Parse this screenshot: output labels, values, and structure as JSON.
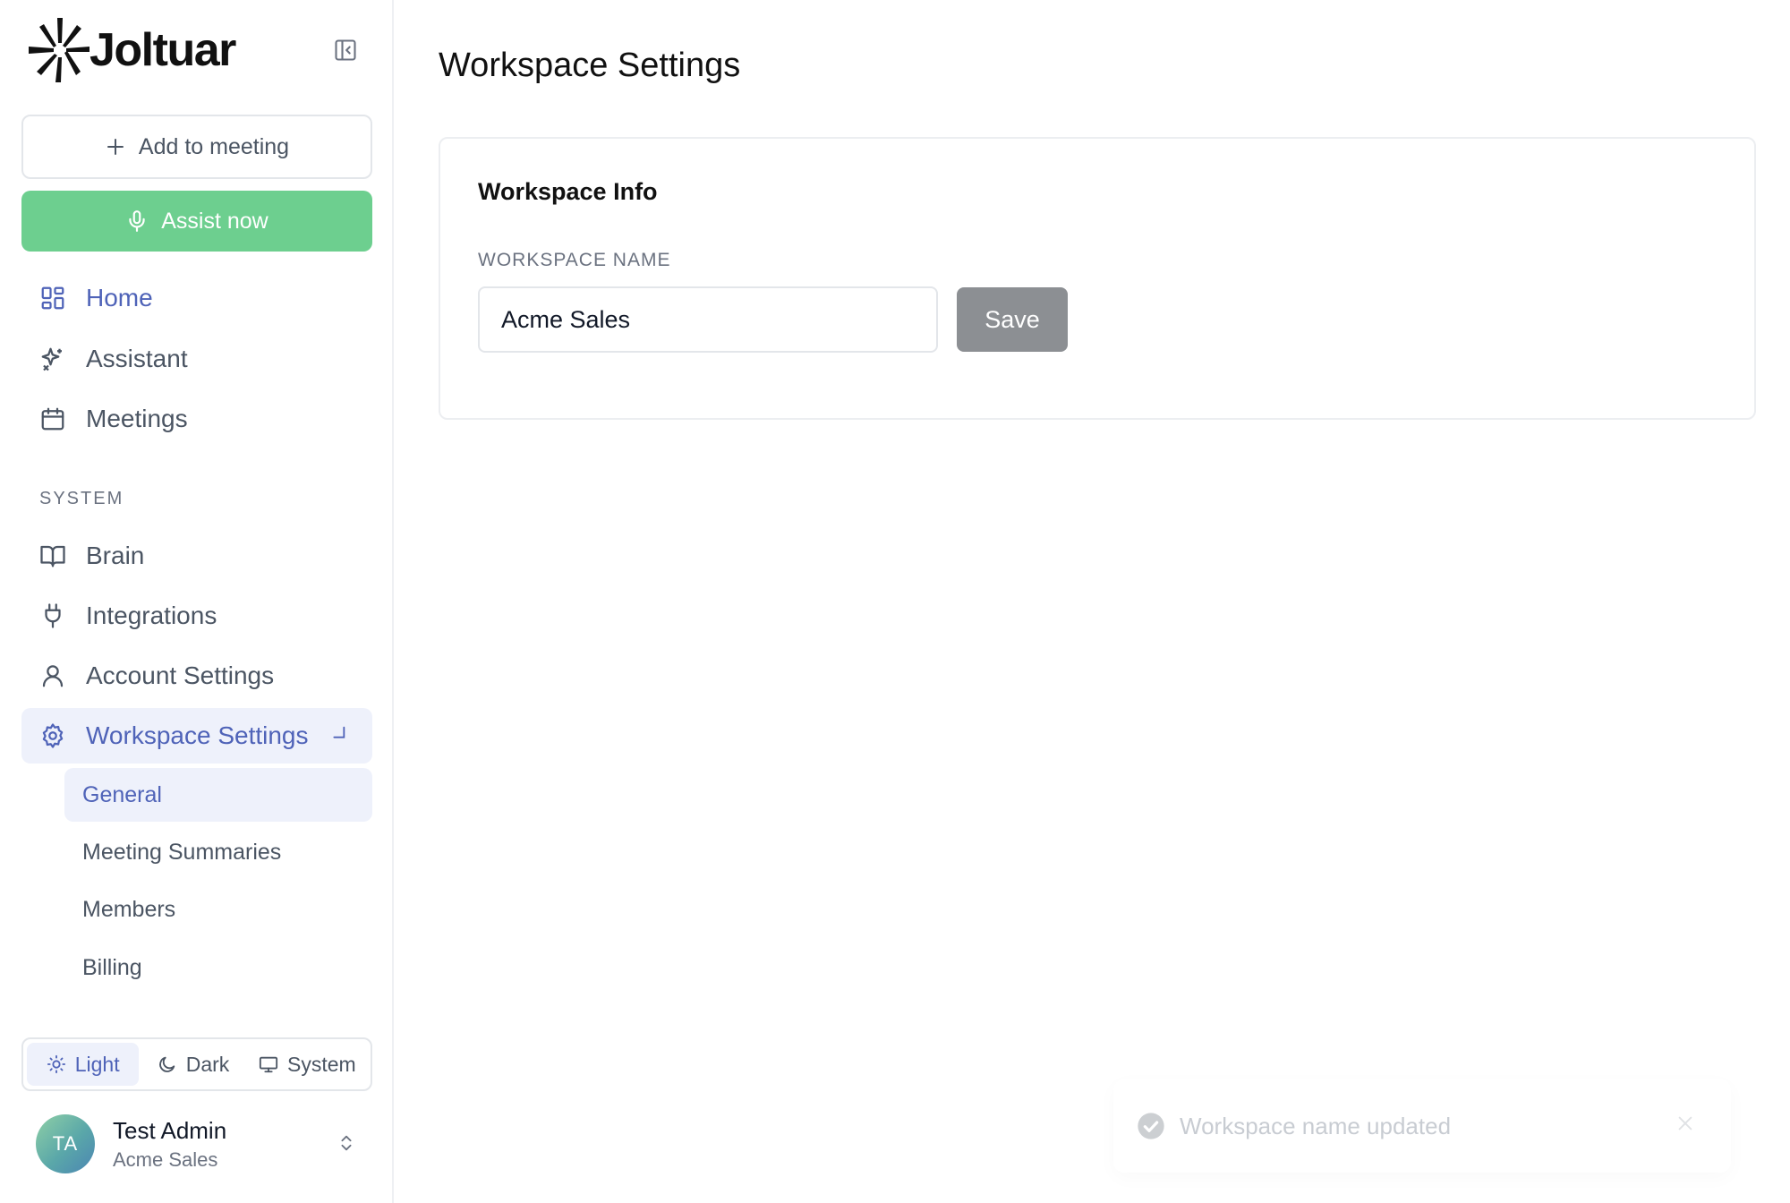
{
  "brand": {
    "name": "Joltuar"
  },
  "sidebar": {
    "add_to_meeting_label": "Add to meeting",
    "assist_now_label": "Assist now",
    "main_nav": [
      {
        "label": "Home",
        "icon": "grid-icon"
      },
      {
        "label": "Assistant",
        "icon": "sparkles-icon"
      },
      {
        "label": "Meetings",
        "icon": "calendar-icon"
      }
    ],
    "system_section_label": "SYSTEM",
    "system_nav": [
      {
        "label": "Brain",
        "icon": "book-icon"
      },
      {
        "label": "Integrations",
        "icon": "plug-icon"
      },
      {
        "label": "Account Settings",
        "icon": "user-icon"
      },
      {
        "label": "Workspace Settings",
        "icon": "gear-icon",
        "selected": true
      }
    ],
    "workspace_subnav": [
      {
        "label": "General",
        "selected": true
      },
      {
        "label": "Meeting Summaries"
      },
      {
        "label": "Members"
      },
      {
        "label": "Billing"
      }
    ],
    "theme": {
      "options": [
        "Light",
        "Dark",
        "System"
      ],
      "selected": "Light"
    },
    "user": {
      "initials": "TA",
      "name": "Test Admin",
      "org": "Acme Sales"
    }
  },
  "main": {
    "page_title": "Workspace Settings",
    "card": {
      "title": "Workspace Info",
      "field_label": "WORKSPACE NAME",
      "field_value": "Acme Sales",
      "save_label": "Save"
    }
  },
  "toast": {
    "message": "Workspace name updated"
  },
  "colors": {
    "accent": "#4f63b8",
    "assist_green": "#6dcf8f",
    "selected_bg": "#eef1fb",
    "save_button": "#8c8f93"
  }
}
